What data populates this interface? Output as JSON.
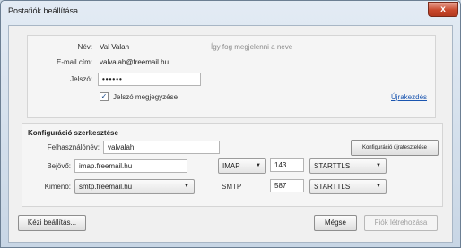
{
  "window": {
    "title": "Postafiók beállítása",
    "close_glyph": "x"
  },
  "account": {
    "name_label": "Név:",
    "name_value": "Val Valah",
    "name_hint": "Így fog megjelenni a neve",
    "email_label": "E-mail cím:",
    "email_value": "valvalah@freemail.hu",
    "password_label": "Jelszó:",
    "password_value": "••••••",
    "remember_label": "Jelszó megjegyzése",
    "remember_checked": true,
    "restart_link": "Újrakezdés"
  },
  "config": {
    "heading": "Konfiguráció szerkesztése",
    "username_label": "Felhasználónév:",
    "username_value": "valvalah",
    "retest_button": "Konfiguráció újratesztelése",
    "incoming": {
      "label": "Bejövő:",
      "server": "imap.freemail.hu",
      "protocol": "IMAP",
      "port": "143",
      "security": "STARTTLS"
    },
    "outgoing": {
      "label": "Kimenő:",
      "server": "smtp.freemail.hu",
      "protocol": "SMTP",
      "port": "587",
      "security": "STARTTLS"
    }
  },
  "footer": {
    "manual_button": "Kézi beállítás...",
    "cancel_button": "Mégse",
    "create_button": "Fiók létrehozása"
  },
  "icons": {
    "dropdown": "chevron-down-icon",
    "checkmark": "checkmark-icon"
  }
}
